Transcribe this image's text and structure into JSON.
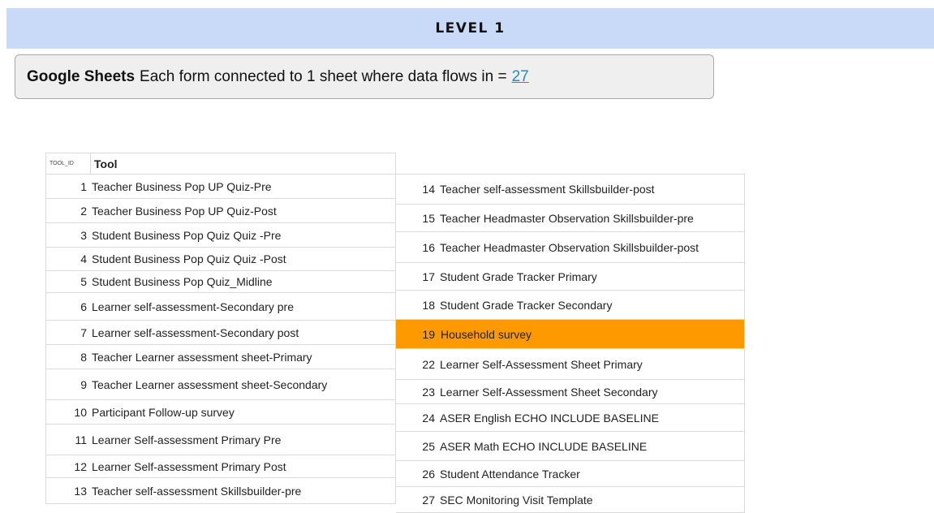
{
  "banner": {
    "title": "LEVEL 1"
  },
  "info": {
    "brand": "Google Sheets",
    "text": "Each form connected to 1 sheet where data flows in =",
    "count": "27"
  },
  "table": {
    "col_id": "TOOL_ID",
    "col_tool": "Tool",
    "left_rows": [
      {
        "id": "1",
        "tool": "Teacher Business Pop UP Quiz-Pre"
      },
      {
        "id": "2",
        "tool": "Teacher Business Pop UP Quiz-Post"
      },
      {
        "id": "3",
        "tool": "Student Business Pop Quiz Quiz -Pre"
      },
      {
        "id": "4",
        "tool": "Student Business Pop Quiz Quiz -Post"
      },
      {
        "id": "5",
        "tool": "Student Business Pop Quiz_Midline"
      },
      {
        "id": "6",
        "tool": "Learner self-assessment-Secondary pre"
      },
      {
        "id": "7",
        "tool": "Learner self-assessment-Secondary post"
      },
      {
        "id": "8",
        "tool": "Teacher Learner assessment sheet-Primary"
      },
      {
        "id": "9",
        "tool": "Teacher Learner assessment sheet-Secondary"
      },
      {
        "id": "10",
        "tool": "Participant Follow-up survey"
      },
      {
        "id": "11",
        "tool": "Learner Self-assessment Primary Pre"
      },
      {
        "id": "12",
        "tool": "Learner Self-assessment Primary Post"
      },
      {
        "id": "13",
        "tool": "Teacher self-assessment Skillsbuilder-pre"
      }
    ],
    "right_rows": [
      {
        "id": "14",
        "tool": "Teacher self-assessment Skillsbuilder-post"
      },
      {
        "id": "15",
        "tool": "Teacher Headmaster Observation Skillsbuilder-pre"
      },
      {
        "id": "16",
        "tool": "Teacher Headmaster Observation Skillsbuilder-post"
      },
      {
        "id": "17",
        "tool": "Student Grade Tracker Primary"
      },
      {
        "id": "18",
        "tool": "Student Grade Tracker Secondary"
      },
      {
        "id": "19",
        "tool": "Household survey"
      },
      {
        "id": "22",
        "tool": "Learner Self-Assessment Sheet Primary"
      },
      {
        "id": "23",
        "tool": "Learner Self-Assessment Sheet Secondary"
      },
      {
        "id": "24",
        "tool": "ASER English ECHO INCLUDE BASELINE"
      },
      {
        "id": "25",
        "tool": "ASER Math ECHO INCLUDE BASELINE"
      },
      {
        "id": "26",
        "tool": "Student Attendance Tracker"
      },
      {
        "id": "27",
        "tool": "SEC Monitoring Visit Template"
      }
    ],
    "highlight_color": "#ff9900",
    "highlight_row_id": "19"
  },
  "colors": {
    "banner_bg": "#c9daf8",
    "info_bg": "#efefef",
    "link": "#1f8fb5"
  }
}
